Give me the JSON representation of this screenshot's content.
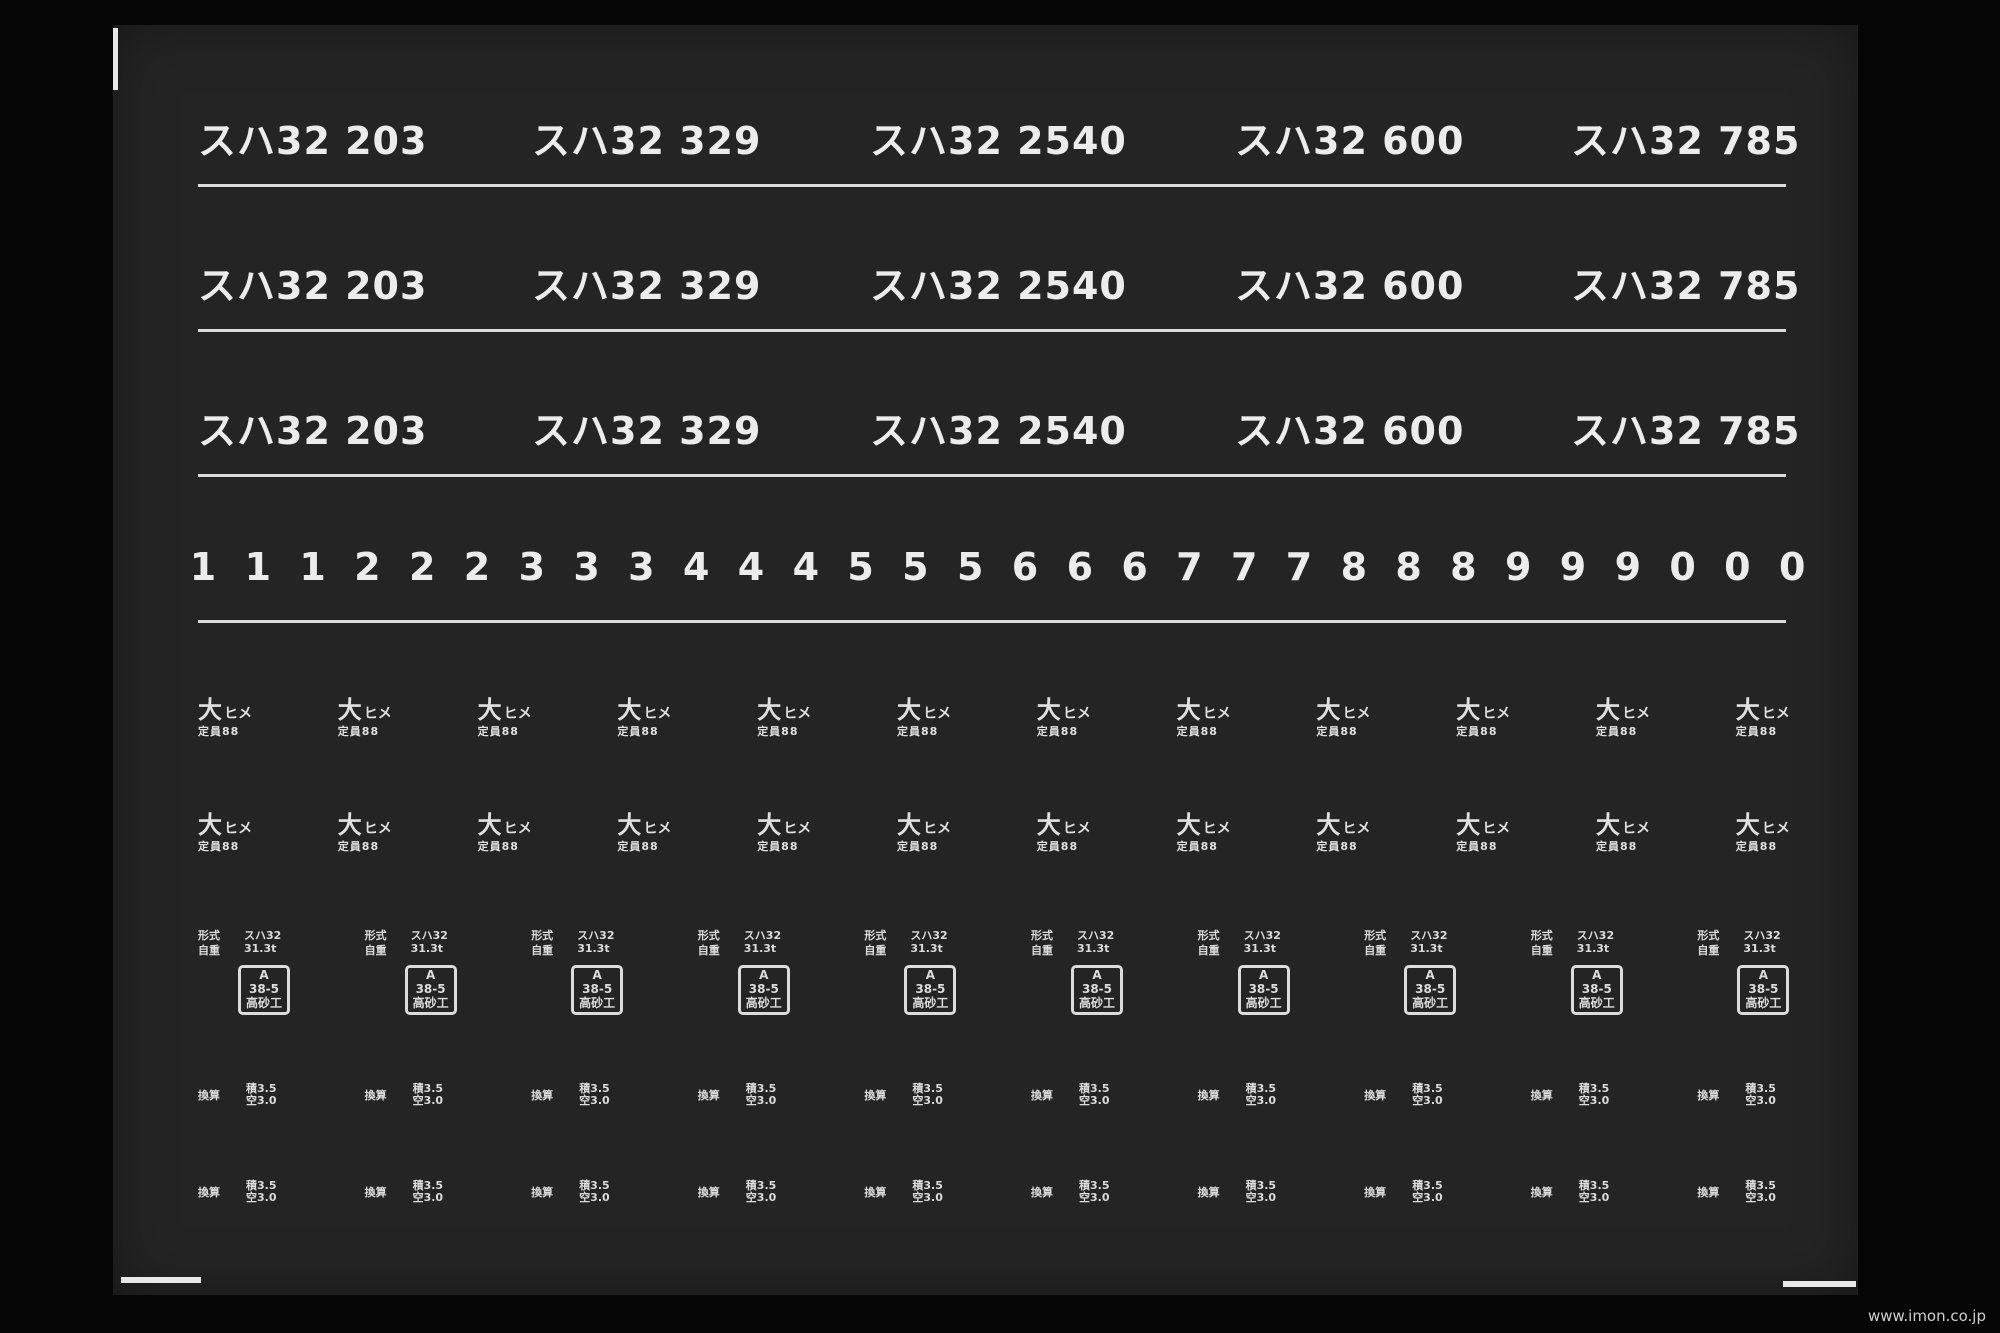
{
  "number_rows": [
    [
      "スハ32 203",
      "スハ32 329",
      "スハ32 2540",
      "スハ32 600",
      "スハ32 785"
    ],
    [
      "スハ32 203",
      "スハ32 329",
      "スハ32 2540",
      "スハ32 600",
      "スハ32 785"
    ],
    [
      "スハ32 203",
      "スハ32 329",
      "スハ32 2540",
      "スハ32 600",
      "スハ32 785"
    ]
  ],
  "digits": [
    "1",
    "1",
    "1",
    "2",
    "2",
    "2",
    "3",
    "3",
    "3",
    "4",
    "4",
    "4",
    "5",
    "5",
    "5",
    "6",
    "6",
    "6",
    "7",
    "7",
    "7",
    "8",
    "8",
    "8",
    "9",
    "9",
    "9",
    "0",
    "0",
    "0"
  ],
  "depot_mark": {
    "kanji": "大",
    "code": "ヒメ",
    "capacity": "定員88",
    "count_per_row": 12,
    "rows": 2
  },
  "data_plate": {
    "type_label": "形式",
    "type_value": "スハ32",
    "weight_label": "自重",
    "weight_value": "31.3t",
    "box_line1": "A",
    "box_line2": "38-5",
    "box_line3": "高砂工",
    "count": 10
  },
  "conversion": {
    "label": "換算",
    "loaded": "積3.5",
    "empty": "空3.0",
    "count_per_row": 10,
    "rows": 2
  },
  "colors": {
    "sheet": "#242424",
    "print": "#e8e8e8",
    "background": "#050505"
  },
  "watermark": "www.imon.co.jp"
}
